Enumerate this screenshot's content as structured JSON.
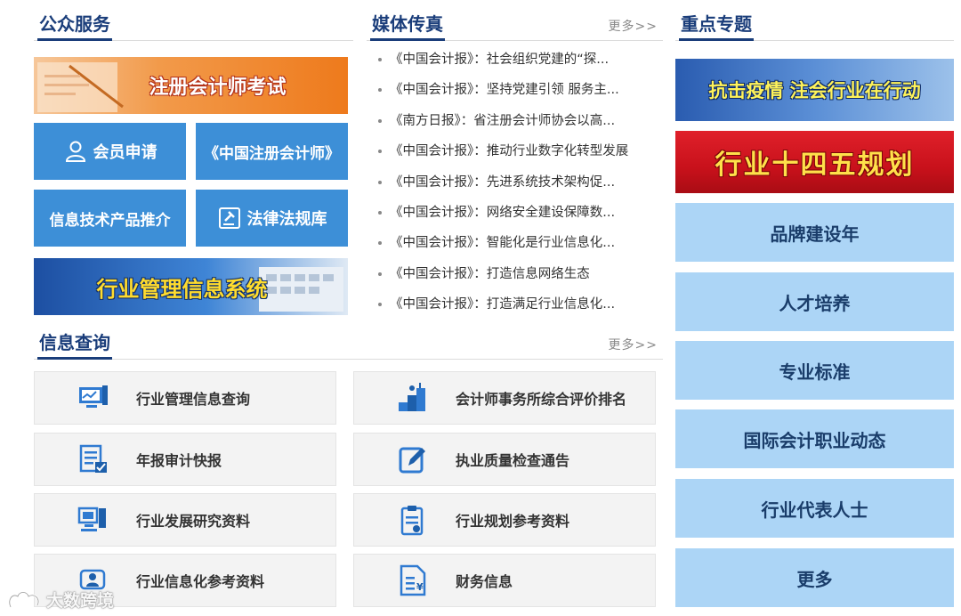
{
  "public_services": {
    "title": "公众服务",
    "exam_banner": "注册会计师考试",
    "tiles": [
      {
        "label": "会员申请",
        "icon": "user-icon"
      },
      {
        "label": "《中国注册会计师》",
        "icon": ""
      },
      {
        "label": "信息技术产品推介",
        "icon": ""
      },
      {
        "label": "法律法规库",
        "icon": "gavel-icon"
      }
    ],
    "system_banner": "行业管理信息系统"
  },
  "media": {
    "title": "媒体传真",
    "more": "更多>>",
    "items": [
      "《中国会计报》：社会组织党建的“探...",
      "《中国会计报》：坚持党建引领 服务主...",
      "《南方日报》：省注册会计师协会以高...",
      "《中国会计报》：推动行业数字化转型发展",
      "《中国会计报》：先进系统技术架构促...",
      "《中国会计报》：网络安全建设保障数...",
      "《中国会计报》：智能化是行业信息化...",
      "《中国会计报》：打造信息网络生态",
      "《中国会计报》：打造满足行业信息化..."
    ]
  },
  "key_topics": {
    "title": "重点专题",
    "banner1": "抗击疫情 注会行业在行动",
    "banner2": "行业十四五规划",
    "buttons": [
      "品牌建设年",
      "人才培养",
      "专业标准",
      "国际会计职业动态",
      "行业代表人士",
      "更多"
    ]
  },
  "info_query": {
    "title": "信息查询",
    "more": "更多>>",
    "items": [
      {
        "label": "行业管理信息查询",
        "icon": "monitor-chart-icon"
      },
      {
        "label": "会计师事务所综合评价排名",
        "icon": "ranking-stairs-icon"
      },
      {
        "label": "年报审计快报",
        "icon": "checklist-icon"
      },
      {
        "label": "执业质量检查通告",
        "icon": "edit-pencil-icon"
      },
      {
        "label": "行业发展研究资料",
        "icon": "computer-icon"
      },
      {
        "label": "行业规划参考资料",
        "icon": "clipboard-icon"
      },
      {
        "label": "行业信息化参考资料",
        "icon": "people-network-icon"
      },
      {
        "label": "财务信息",
        "icon": "finance-document-icon"
      }
    ]
  },
  "watermark": "大数跨境",
  "colors": {
    "accent_dark": "#1a3d7a",
    "tile_blue": "#3d8fd7",
    "light_blue": "#acd5f6",
    "banner_red": "#c8111b"
  }
}
